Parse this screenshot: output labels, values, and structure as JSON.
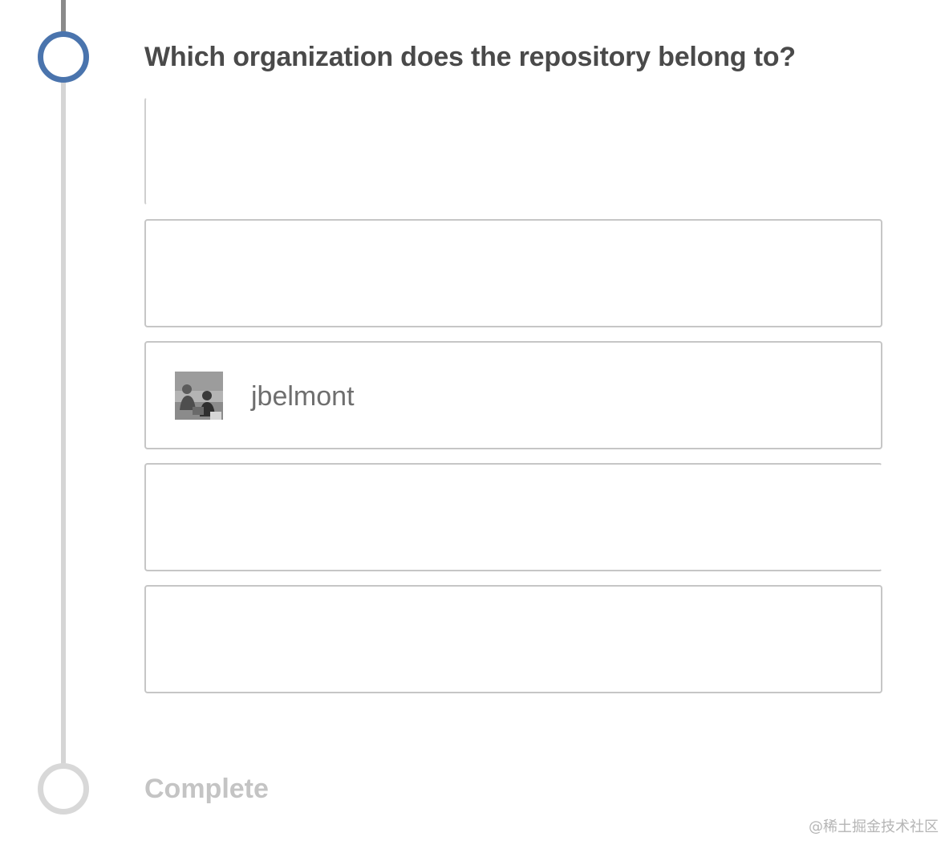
{
  "question": {
    "title": "Which organization does the repository belong to?"
  },
  "options": [
    {
      "label": ""
    },
    {
      "label": ""
    },
    {
      "label": "jbelmont",
      "avatar": "user-avatar-photo"
    },
    {
      "label": ""
    },
    {
      "label": ""
    }
  ],
  "steps": {
    "complete_label": "Complete"
  },
  "watermark": "@稀土掘金技术社区",
  "colors": {
    "active_step": "#4a74ad",
    "inactive_step": "#d8d8d8",
    "timeline": "#d5d5d5",
    "question_text": "#4a4a4a",
    "muted_text": "#c4c4c4"
  }
}
